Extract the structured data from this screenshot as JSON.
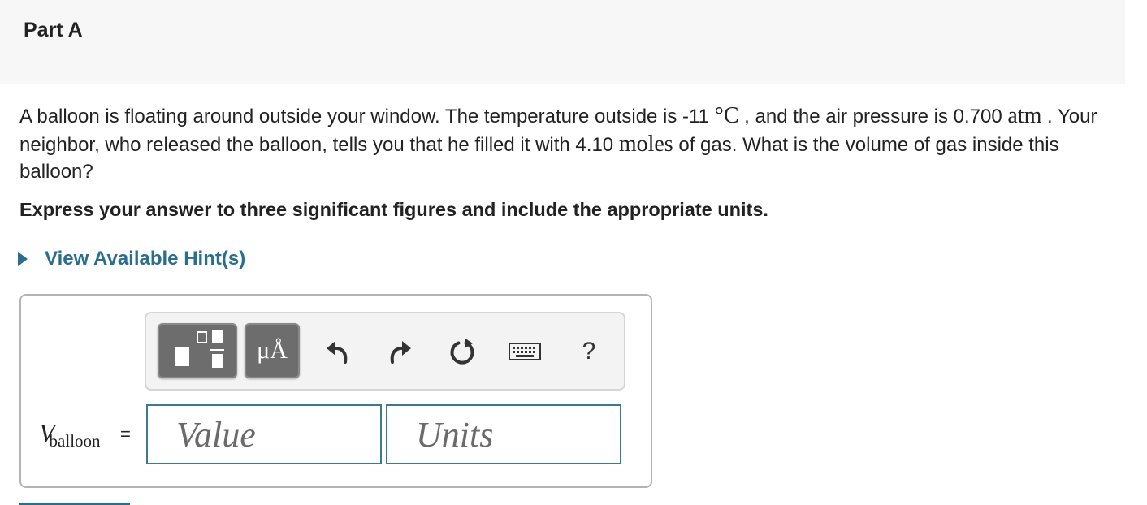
{
  "part": {
    "title": "Part A"
  },
  "problem": {
    "t1": "A balloon is floating around outside your window. The temperature outside is -11 ",
    "u1": "°C",
    "t2": " , and the air pressure is 0.700 ",
    "u2": "atm",
    "t3": " . Your neighbor, who released the balloon, tells you that he filled it with 4.10 ",
    "u3": "moles",
    "t4": " of gas. What is the volume of gas inside this balloon?"
  },
  "instruction": "Express your answer to three significant figures and include the appropriate units.",
  "hint": {
    "label": "View Available Hint(s)"
  },
  "toolbar": {
    "units_button": "μÅ",
    "help_label": "?",
    "icons": [
      "template-icon",
      "units-icon",
      "undo-icon",
      "redo-icon",
      "reset-icon",
      "keyboard-icon",
      "help-icon"
    ]
  },
  "answer": {
    "variable": "V",
    "subscript": "balloon",
    "equals": "=",
    "value_placeholder": "Value",
    "units_placeholder": "Units"
  },
  "colors": {
    "link": "#2a6e8f",
    "field_border": "#3b7c8c",
    "header_bg": "#f7f7f7"
  }
}
